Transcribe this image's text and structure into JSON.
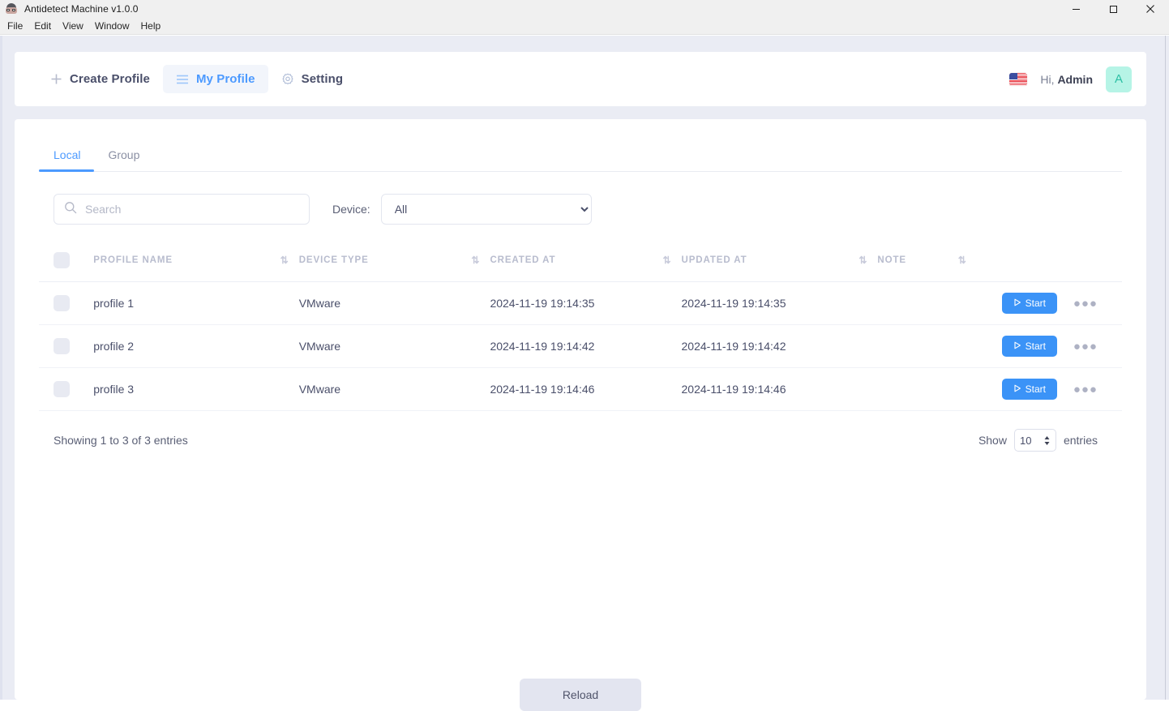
{
  "window": {
    "title": "Antidetect Machine v1.0.0",
    "app_icon": "raccoon-icon",
    "controls": [
      {
        "name": "minimize-button",
        "glyph": "minimize-icon"
      },
      {
        "name": "maximize-button",
        "glyph": "maximize-icon"
      },
      {
        "name": "close-button",
        "glyph": "close-icon"
      }
    ]
  },
  "menubar": {
    "items": [
      {
        "label": "File"
      },
      {
        "label": "Edit"
      },
      {
        "label": "View"
      },
      {
        "label": "Window"
      },
      {
        "label": "Help"
      }
    ]
  },
  "header": {
    "nav": [
      {
        "label": "Create Profile",
        "icon": "plus-icon",
        "active": false
      },
      {
        "label": "My Profile",
        "icon": "hamburger-icon",
        "active": true
      },
      {
        "label": "Setting",
        "icon": "gear-icon",
        "active": false
      }
    ],
    "locale_flag": "us-flag-icon",
    "greeting_prefix": "Hi,",
    "user_name": "Admin",
    "avatar_initial": "A"
  },
  "tabs": [
    {
      "label": "Local",
      "active": true
    },
    {
      "label": "Group",
      "active": false
    }
  ],
  "filters": {
    "search_placeholder": "Search",
    "search_value": "",
    "device_label": "Device:",
    "device_selected": "All",
    "device_options": [
      "All"
    ]
  },
  "table": {
    "columns": [
      {
        "label": "PROFILE NAME",
        "sortable": true
      },
      {
        "label": "DEVICE TYPE",
        "sortable": true
      },
      {
        "label": "CREATED AT",
        "sortable": true
      },
      {
        "label": "UPDATED AT",
        "sortable": true
      },
      {
        "label": "NOTE",
        "sortable": true
      }
    ],
    "sort_icon": "⇅",
    "rows": [
      {
        "profile_name": "profile 1",
        "device_type": "VMware",
        "created_at": "2024-11-19 19:14:35",
        "updated_at": "2024-11-19 19:14:35",
        "note": "",
        "action_label": "Start"
      },
      {
        "profile_name": "profile 2",
        "device_type": "VMware",
        "created_at": "2024-11-19 19:14:42",
        "updated_at": "2024-11-19 19:14:42",
        "note": "",
        "action_label": "Start"
      },
      {
        "profile_name": "profile 3",
        "device_type": "VMware",
        "created_at": "2024-11-19 19:14:46",
        "updated_at": "2024-11-19 19:14:46",
        "note": "",
        "action_label": "Start"
      }
    ]
  },
  "footer": {
    "entries_info": "Showing 1 to 3 of 3 entries",
    "show_label": "Show",
    "page_size": "10",
    "entries_label": "entries",
    "reload_label": "Reload"
  },
  "colors": {
    "accent_blue": "#4c9aff",
    "button_blue": "#3b93f7",
    "page_bg": "#eaecf4",
    "avatar_bg": "#b6f4e6",
    "avatar_fg": "#2bbfa4"
  }
}
